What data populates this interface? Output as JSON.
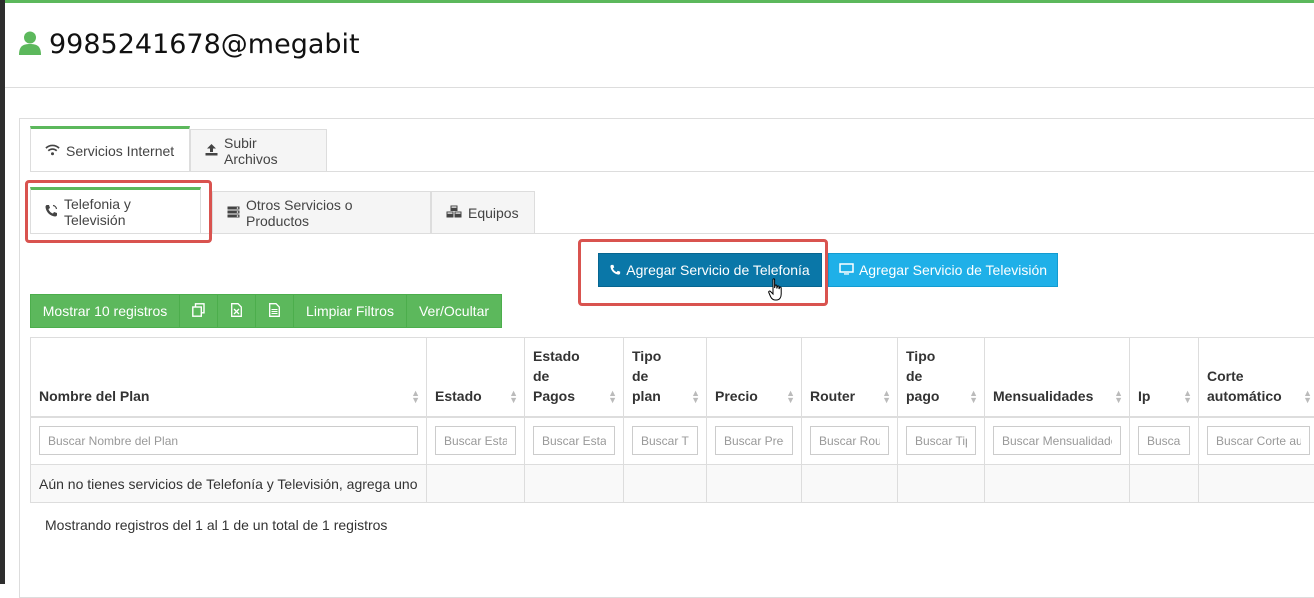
{
  "header": {
    "title": "9985241678@megabit",
    "icon": "user-icon"
  },
  "tabs_primary": [
    {
      "label": "Servicios Internet",
      "icon": "wifi-icon",
      "active": true
    },
    {
      "label": "Subir Archivos",
      "icon": "upload-icon",
      "active": false
    }
  ],
  "tabs_secondary": [
    {
      "label": "Telefonia y Televisión",
      "icon": "phone-signal-icon",
      "active": true
    },
    {
      "label": "Otros Servicios o Productos",
      "icon": "server-icon",
      "active": false
    },
    {
      "label": "Equipos",
      "icon": "cubes-icon",
      "active": false
    }
  ],
  "actions": {
    "add_phone": "Agregar Servicio de Telefonía",
    "add_tv": "Agregar Servicio de Televisión"
  },
  "toolbar": {
    "show_records": "Mostrar 10 registros",
    "copy_icon": "copy-icon",
    "excel_icon": "excel-icon",
    "pdf_icon": "document-icon",
    "clear_filters": "Limpiar Filtros",
    "toggle_columns": "Ver/Ocultar"
  },
  "table": {
    "columns": [
      {
        "h1": "",
        "h2": "",
        "h3": "Nombre del Plan",
        "placeholder": "Buscar Nombre del Plan"
      },
      {
        "h1": "",
        "h2": "",
        "h3": "Estado",
        "placeholder": "Buscar Estado"
      },
      {
        "h1": "Estado",
        "h2": "de",
        "h3": "Pagos",
        "placeholder": "Buscar Estado de Pagos"
      },
      {
        "h1": "Tipo",
        "h2": "de",
        "h3": "plan",
        "placeholder": "Buscar Tipo de plan"
      },
      {
        "h1": "",
        "h2": "",
        "h3": "Precio",
        "placeholder": "Buscar Precio"
      },
      {
        "h1": "",
        "h2": "",
        "h3": "Router",
        "placeholder": "Buscar Router"
      },
      {
        "h1": "Tipo",
        "h2": "de",
        "h3": "pago",
        "placeholder": "Buscar Tipo de pago"
      },
      {
        "h1": "",
        "h2": "",
        "h3": "Mensualidades",
        "placeholder": "Buscar Mensualidades"
      },
      {
        "h1": "",
        "h2": "",
        "h3": "Ip",
        "placeholder": "Buscar Ip"
      },
      {
        "h1": "",
        "h2": "Corte",
        "h3": "automático",
        "placeholder": "Buscar Corte automático"
      }
    ],
    "empty_message": "Aún no tienes servicios de Telefonía y Televisión, agrega uno"
  },
  "info": "Mostrando registros del 1 al 1 de un total de 1 registros",
  "colors": {
    "accent_green": "#5cb85c",
    "highlight_red": "#d9534f",
    "phone_button": "#0a77a8",
    "tv_button": "#1fb0e8"
  }
}
